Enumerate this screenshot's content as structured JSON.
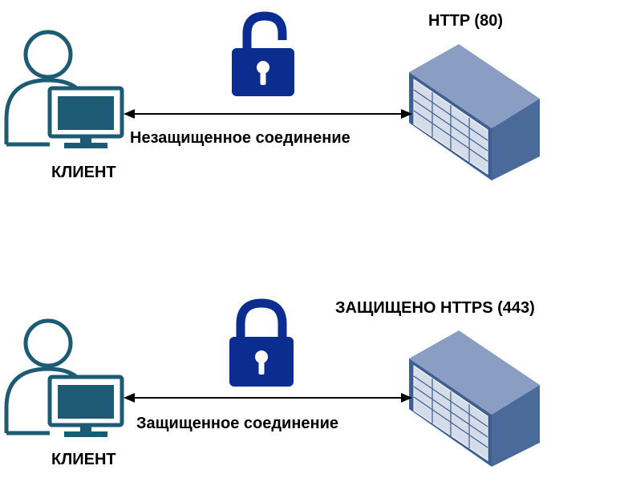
{
  "scenarios": [
    {
      "id": "insecure",
      "client_label": "КЛИЕНТ",
      "server_label": "HTTP (80)",
      "connection_label": "Незащищенное соединение",
      "lock_state": "unlocked",
      "lock_icon": "unlocked-padlock-icon"
    },
    {
      "id": "secure",
      "client_label": "КЛИЕНТ",
      "server_label": "ЗАЩИЩЕНО HTTPS (443)",
      "connection_label": "Защищенное соединение",
      "lock_state": "locked",
      "lock_icon": "locked-padlock-icon"
    }
  ],
  "colors": {
    "user_outline": "#1d5a73",
    "monitor": "#1d5a73",
    "lock": "#0a2d8f",
    "server_side": "#4a6a9a",
    "server_front": "#c9d3e3",
    "server_top": "#8a9ec4"
  }
}
